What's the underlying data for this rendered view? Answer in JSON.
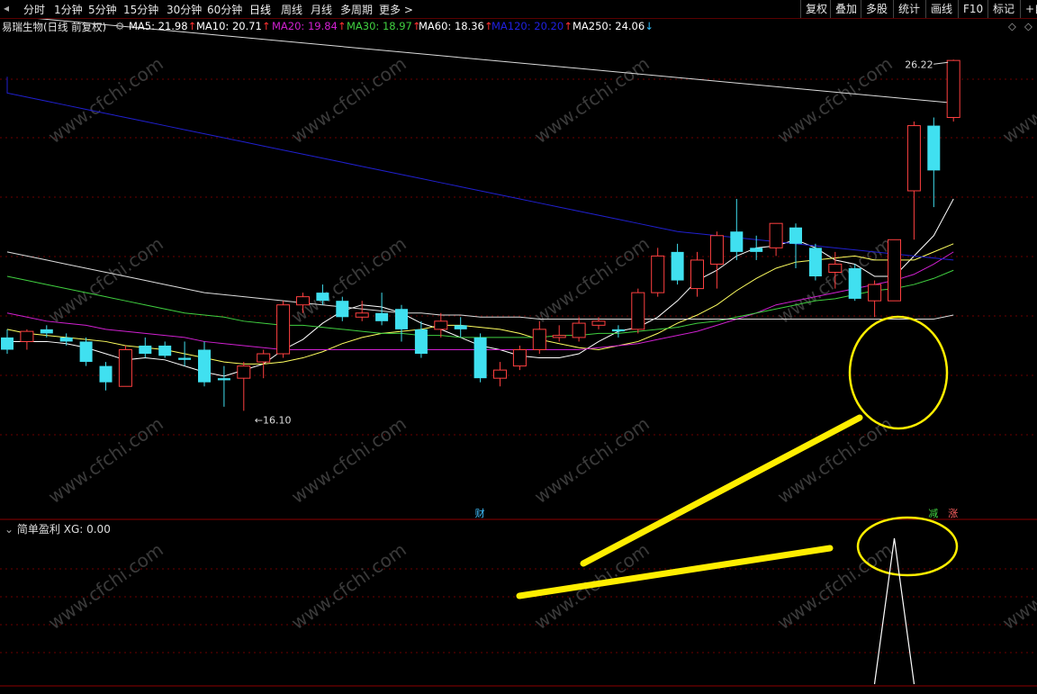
{
  "toolbar": {
    "periods": [
      "分时",
      "1分钟",
      "5分钟",
      "15分钟",
      "30分钟",
      "60分钟",
      "日线",
      "周线",
      "月线",
      "多周期",
      "更多"
    ],
    "active_period": "日线",
    "right_buttons": [
      "复权",
      "叠加",
      "多股",
      "统计",
      "画线",
      "F10",
      "标记",
      "+自"
    ]
  },
  "legend": {
    "stock_name": "易瑞生物(日线 前复权)",
    "items": [
      {
        "label": "MA5: 21.98",
        "arrow": "↑",
        "color": "#ffffff"
      },
      {
        "label": "MA10: 20.71",
        "arrow": "↑",
        "color": "#ffffff"
      },
      {
        "label": "MA20: 19.84",
        "arrow": "↑",
        "color": "#d020d0"
      },
      {
        "label": "MA30: 18.97",
        "arrow": "↑",
        "color": "#40d040"
      },
      {
        "label": "MA60: 18.36",
        "arrow": "↑",
        "color": "#ffffff"
      },
      {
        "label": "MA120: 20.20",
        "arrow": "↑",
        "color": "#2020e0"
      },
      {
        "label": "MA250: 24.06",
        "arrow": "↓",
        "color": "#ffffff"
      }
    ],
    "arrow_up_color": "#ff3030",
    "arrow_down_color": "#30c0ff"
  },
  "sub_panel": {
    "title": "简单盈利",
    "value_label": "XG: 0.00"
  },
  "markers": {
    "cai": "财",
    "jian": "减",
    "zhang": "涨"
  },
  "price_labels": {
    "high": "26.22",
    "low": "16.10"
  },
  "watermark": "www.cfchi.com",
  "colors": {
    "up": "#ff4040",
    "down": "#40e0f0",
    "ma5": "#ffffff",
    "ma10": "#ffff60",
    "ma20": "#d020d0",
    "ma30": "#40d040",
    "ma60": "#dddddd",
    "ma120": "#2020d0",
    "ma250": "#dddddd",
    "annotation": "#ffee00",
    "grid": "#6b0000"
  },
  "chart_data": {
    "type": "candlestick",
    "ylim": [
      15.2,
      26.8
    ],
    "candles": [
      {
        "o": 19.4,
        "h": 19.6,
        "l": 19.0,
        "c": 19.1
      },
      {
        "o": 19.3,
        "h": 19.6,
        "l": 19.1,
        "c": 19.55
      },
      {
        "o": 19.6,
        "h": 19.7,
        "l": 19.4,
        "c": 19.5
      },
      {
        "o": 19.4,
        "h": 19.5,
        "l": 19.2,
        "c": 19.3
      },
      {
        "o": 19.3,
        "h": 19.4,
        "l": 18.7,
        "c": 18.8
      },
      {
        "o": 18.7,
        "h": 18.8,
        "l": 18.1,
        "c": 18.3
      },
      {
        "o": 18.2,
        "h": 19.2,
        "l": 18.2,
        "c": 19.1
      },
      {
        "o": 19.2,
        "h": 19.4,
        "l": 18.9,
        "c": 19.0
      },
      {
        "o": 19.2,
        "h": 19.3,
        "l": 18.9,
        "c": 18.95
      },
      {
        "o": 18.9,
        "h": 19.3,
        "l": 18.7,
        "c": 18.85
      },
      {
        "o": 19.1,
        "h": 19.3,
        "l": 18.2,
        "c": 18.3
      },
      {
        "o": 18.4,
        "h": 18.7,
        "l": 17.7,
        "c": 18.35
      },
      {
        "o": 18.4,
        "h": 18.8,
        "l": 17.6,
        "c": 18.7
      },
      {
        "o": 18.8,
        "h": 19.1,
        "l": 18.4,
        "c": 19.0
      },
      {
        "o": 19.0,
        "h": 20.3,
        "l": 18.9,
        "c": 20.2
      },
      {
        "o": 20.2,
        "h": 20.5,
        "l": 20.0,
        "c": 20.4
      },
      {
        "o": 20.5,
        "h": 20.7,
        "l": 20.2,
        "c": 20.3
      },
      {
        "o": 20.3,
        "h": 20.4,
        "l": 19.8,
        "c": 19.9
      },
      {
        "o": 19.9,
        "h": 20.3,
        "l": 19.8,
        "c": 20.0
      },
      {
        "o": 20.0,
        "h": 20.5,
        "l": 19.7,
        "c": 19.8
      },
      {
        "o": 20.1,
        "h": 20.2,
        "l": 19.3,
        "c": 19.6
      },
      {
        "o": 19.6,
        "h": 19.8,
        "l": 18.9,
        "c": 19.0
      },
      {
        "o": 19.6,
        "h": 20.0,
        "l": 19.4,
        "c": 19.8
      },
      {
        "o": 19.7,
        "h": 19.9,
        "l": 19.4,
        "c": 19.6
      },
      {
        "o": 19.4,
        "h": 19.5,
        "l": 18.3,
        "c": 18.4
      },
      {
        "o": 18.4,
        "h": 18.8,
        "l": 18.2,
        "c": 18.6
      },
      {
        "o": 18.7,
        "h": 19.2,
        "l": 18.6,
        "c": 19.1
      },
      {
        "o": 19.1,
        "h": 19.8,
        "l": 19.0,
        "c": 19.6
      },
      {
        "o": 19.4,
        "h": 19.7,
        "l": 19.3,
        "c": 19.45
      },
      {
        "o": 19.4,
        "h": 19.9,
        "l": 19.3,
        "c": 19.75
      },
      {
        "o": 19.7,
        "h": 19.9,
        "l": 19.6,
        "c": 19.8
      },
      {
        "o": 19.6,
        "h": 19.7,
        "l": 19.4,
        "c": 19.55
      },
      {
        "o": 19.6,
        "h": 20.6,
        "l": 19.5,
        "c": 20.5
      },
      {
        "o": 20.5,
        "h": 21.6,
        "l": 20.4,
        "c": 21.4
      },
      {
        "o": 21.5,
        "h": 21.7,
        "l": 20.7,
        "c": 20.8
      },
      {
        "o": 20.6,
        "h": 21.5,
        "l": 20.4,
        "c": 21.3
      },
      {
        "o": 21.2,
        "h": 22.0,
        "l": 20.6,
        "c": 21.9
      },
      {
        "o": 22.0,
        "h": 22.8,
        "l": 21.3,
        "c": 21.5
      },
      {
        "o": 21.6,
        "h": 21.9,
        "l": 21.3,
        "c": 21.5
      },
      {
        "o": 21.6,
        "h": 22.2,
        "l": 21.4,
        "c": 22.2
      },
      {
        "o": 22.1,
        "h": 22.2,
        "l": 21.1,
        "c": 21.7
      },
      {
        "o": 21.6,
        "h": 21.7,
        "l": 20.8,
        "c": 20.9
      },
      {
        "o": 21.0,
        "h": 21.5,
        "l": 20.6,
        "c": 21.2
      },
      {
        "o": 21.1,
        "h": 21.2,
        "l": 20.3,
        "c": 20.35
      },
      {
        "o": 20.3,
        "h": 20.8,
        "l": 19.9,
        "c": 20.7
      },
      {
        "o": 20.3,
        "h": 21.8,
        "l": 20.3,
        "c": 21.8
      },
      {
        "o": 23.0,
        "h": 24.7,
        "l": 21.8,
        "c": 24.6
      },
      {
        "o": 24.6,
        "h": 24.8,
        "l": 22.6,
        "c": 23.5
      },
      {
        "o": 24.8,
        "h": 26.22,
        "l": 24.7,
        "c": 26.2
      }
    ],
    "ma_series": [
      {
        "name": "MA5",
        "values": [
          19.3,
          19.3,
          19.3,
          19.25,
          19.15,
          19.0,
          18.85,
          18.9,
          18.85,
          18.7,
          18.55,
          18.45,
          18.6,
          18.75,
          19.1,
          19.35,
          19.75,
          20.05,
          20.2,
          20.15,
          20.0,
          19.75,
          19.6,
          19.4,
          19.2,
          19.1,
          18.95,
          18.9,
          18.9,
          19.0,
          19.3,
          19.55,
          19.65,
          19.9,
          20.3,
          20.8,
          21.05,
          21.4,
          21.6,
          21.65,
          21.8,
          21.6,
          21.3,
          21.2,
          20.9,
          20.9,
          21.4,
          21.9,
          22.8
        ]
      },
      {
        "name": "MA10",
        "values": [
          19.6,
          19.5,
          19.45,
          19.4,
          19.35,
          19.3,
          19.2,
          19.15,
          19.1,
          19.0,
          18.9,
          18.8,
          18.75,
          18.75,
          18.8,
          18.9,
          19.05,
          19.25,
          19.4,
          19.5,
          19.55,
          19.6,
          19.7,
          19.7,
          19.65,
          19.6,
          19.5,
          19.35,
          19.25,
          19.15,
          19.1,
          19.2,
          19.3,
          19.5,
          19.75,
          19.95,
          20.2,
          20.55,
          20.85,
          21.1,
          21.25,
          21.3,
          21.35,
          21.4,
          21.3,
          21.3,
          21.3,
          21.5,
          21.7
        ]
      },
      {
        "name": "MA20",
        "values": [
          20.0,
          19.9,
          19.8,
          19.75,
          19.7,
          19.6,
          19.55,
          19.5,
          19.45,
          19.4,
          19.3,
          19.25,
          19.2,
          19.15,
          19.1,
          19.1,
          19.1,
          19.1,
          19.1,
          19.1,
          19.1,
          19.1,
          19.1,
          19.1,
          19.1,
          19.1,
          19.1,
          19.1,
          19.1,
          19.1,
          19.15,
          19.2,
          19.25,
          19.35,
          19.45,
          19.55,
          19.7,
          19.85,
          20.0,
          20.2,
          20.3,
          20.4,
          20.5,
          20.6,
          20.7,
          20.8,
          20.95,
          21.2,
          21.5
        ]
      },
      {
        "name": "MA30",
        "values": [
          20.9,
          20.8,
          20.7,
          20.6,
          20.5,
          20.4,
          20.3,
          20.2,
          20.1,
          20.0,
          19.95,
          19.9,
          19.8,
          19.75,
          19.7,
          19.7,
          19.65,
          19.6,
          19.55,
          19.5,
          19.5,
          19.45,
          19.45,
          19.4,
          19.4,
          19.4,
          19.4,
          19.4,
          19.45,
          19.45,
          19.5,
          19.5,
          19.55,
          19.6,
          19.65,
          19.75,
          19.8,
          19.9,
          20.0,
          20.1,
          20.2,
          20.3,
          20.35,
          20.45,
          20.55,
          20.6,
          20.7,
          20.85,
          21.05
        ]
      },
      {
        "name": "MA60",
        "values": [
          21.5,
          21.4,
          21.3,
          21.2,
          21.1,
          21.0,
          20.9,
          20.8,
          20.7,
          20.6,
          20.5,
          20.45,
          20.4,
          20.35,
          20.3,
          20.25,
          20.2,
          20.15,
          20.1,
          20.05,
          20.0,
          20.0,
          19.95,
          19.95,
          19.9,
          19.9,
          19.9,
          19.85,
          19.85,
          19.85,
          19.85,
          19.85,
          19.85,
          19.85,
          19.85,
          19.85,
          19.85,
          19.85,
          19.85,
          19.85,
          19.85,
          19.85,
          19.85,
          19.85,
          19.85,
          19.85,
          19.85,
          19.85,
          19.95
        ]
      },
      {
        "name": "MA120",
        "values": [
          25.4,
          25.3,
          25.2,
          25.1,
          25.0,
          24.9,
          24.8,
          24.7,
          24.6,
          24.5,
          24.4,
          24.3,
          24.2,
          24.1,
          24.0,
          23.9,
          23.8,
          23.7,
          23.6,
          23.5,
          23.4,
          23.3,
          23.2,
          23.1,
          23.0,
          22.9,
          22.8,
          22.7,
          22.6,
          22.5,
          22.4,
          22.3,
          22.2,
          22.1,
          22.0,
          21.95,
          21.9,
          21.85,
          21.8,
          21.75,
          21.7,
          21.65,
          21.6,
          21.55,
          21.5,
          21.45,
          21.4,
          21.35,
          21.3
        ]
      }
    ],
    "ma250_line": {
      "name": "MA250",
      "from": 27.3,
      "to": 25.15
    },
    "xg_signal_index": 45
  }
}
